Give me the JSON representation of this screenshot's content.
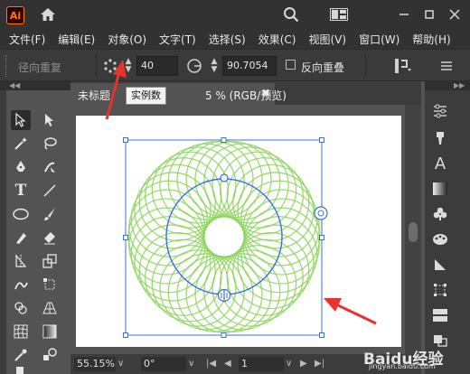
{
  "app": {
    "logo_text": "Ai"
  },
  "menu": [
    "文件(F)",
    "编辑(E)",
    "对象(O)",
    "文字(T)",
    "选择(S)",
    "效果(C)",
    "视图(V)",
    "窗口(W)",
    "帮助(H)"
  ],
  "control_bar": {
    "title": "径向重复",
    "instances_value": "40",
    "radius_value": "90.7054",
    "reverse_overlap_label": "反向重叠"
  },
  "tooltip": {
    "text": "实例数"
  },
  "document": {
    "tab_name": "未标题",
    "tab_status": "5 % (RGB/预览)"
  },
  "status_bar": {
    "zoom": "55.15%",
    "rotation": "0°",
    "artboard_number": "1"
  },
  "watermark": {
    "text": "Baidu经验",
    "sub": "jingyan.baidu.com"
  },
  "colors": {
    "accent_red": "#e8322e",
    "artwork_green": "#8cd45a",
    "selection_blue": "#3b6fe0",
    "app_orange": "#ff7c00"
  }
}
